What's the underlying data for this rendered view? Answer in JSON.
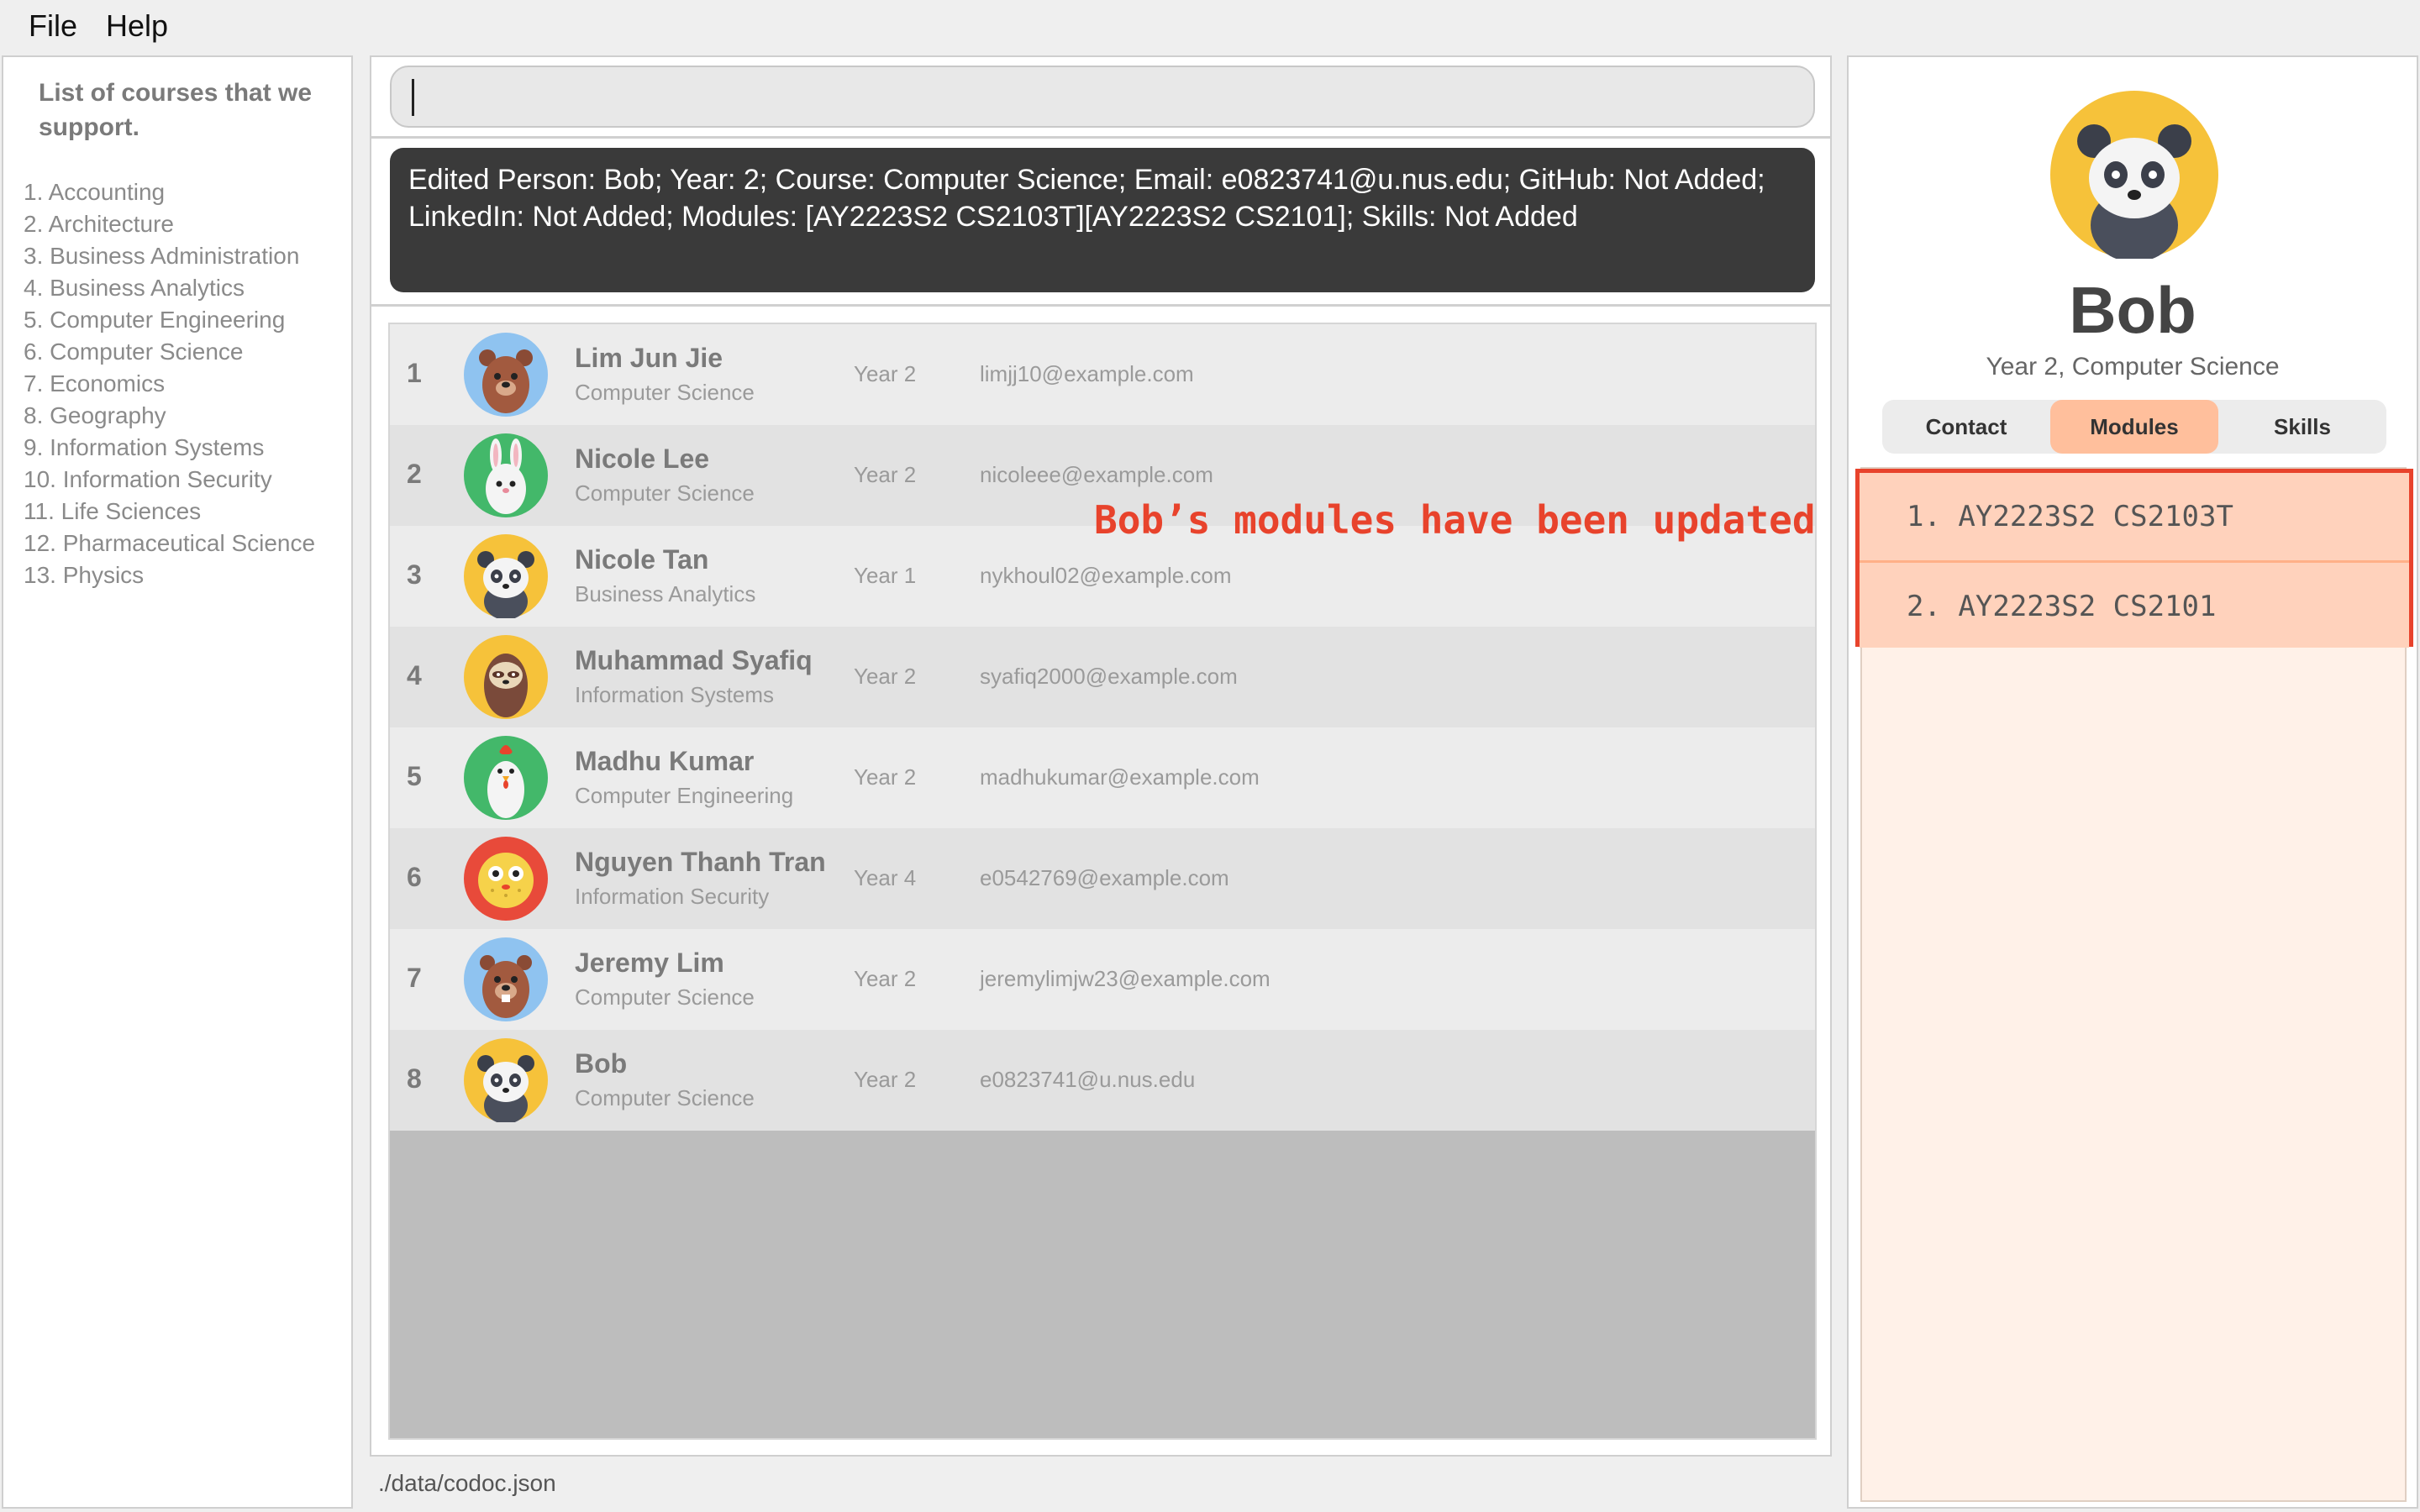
{
  "menu": {
    "file": "File",
    "help": "Help"
  },
  "sidebar": {
    "title": "List of courses that we support.",
    "courses": [
      "1. Accounting",
      "2. Architecture",
      "3. Business Administration",
      "4. Business Analytics",
      "5. Computer Engineering",
      "6. Computer Science",
      "7. Economics",
      "8. Geography",
      "9. Information Systems",
      "10. Information Security",
      "11. Life Sciences",
      "12. Pharmaceutical Science",
      "13. Physics"
    ]
  },
  "command": {
    "value": ""
  },
  "result": {
    "text": "Edited Person: Bob; Year: 2; Course: Computer Science; Email: e0823741@u.nus.edu; GitHub: Not Added; LinkedIn: Not Added; Modules: [AY2223S2 CS2103T][AY2223S2 CS2101]; Skills: Not Added"
  },
  "persons": [
    {
      "index": "1",
      "name": "Lim Jun Jie",
      "course": "Computer Science",
      "year": "Year 2",
      "email": "limjj10@example.com",
      "avatar": "bear-icon"
    },
    {
      "index": "2",
      "name": "Nicole Lee",
      "course": "Computer Science",
      "year": "Year 2",
      "email": "nicoleee@example.com",
      "avatar": "rabbit-icon"
    },
    {
      "index": "3",
      "name": "Nicole Tan",
      "course": "Business Analytics",
      "year": "Year 1",
      "email": "nykhoul02@example.com",
      "avatar": "panda-icon"
    },
    {
      "index": "4",
      "name": "Muhammad Syafiq",
      "course": "Information Systems",
      "year": "Year 2",
      "email": "syafiq2000@example.com",
      "avatar": "sloth-icon"
    },
    {
      "index": "5",
      "name": "Madhu Kumar",
      "course": "Computer Engineering",
      "year": "Year 2",
      "email": "madhukumar@example.com",
      "avatar": "chicken-icon"
    },
    {
      "index": "6",
      "name": "Nguyen Thanh Tran",
      "course": "Information Security",
      "year": "Year 4",
      "email": "e0542769@example.com",
      "avatar": "pufferfish-icon"
    },
    {
      "index": "7",
      "name": "Jeremy Lim",
      "course": "Computer Science",
      "year": "Year 2",
      "email": "jeremylimjw23@example.com",
      "avatar": "beaver-icon"
    },
    {
      "index": "8",
      "name": "Bob",
      "course": "Computer Science",
      "year": "Year 2",
      "email": "e0823741@u.nus.edu",
      "avatar": "panda-icon"
    }
  ],
  "status": {
    "path": "./data/codoc.json"
  },
  "detail": {
    "name": "Bob",
    "subtitle": "Year 2, Computer Science",
    "avatar": "panda-icon",
    "tabs": [
      "Contact",
      "Modules",
      "Skills"
    ],
    "active_tab": "Modules",
    "modules": [
      "1.  AY2223S2 CS2103T",
      "2.  AY2223S2 CS2101"
    ]
  },
  "annotation": {
    "text": "Bob’s modules have been updated"
  },
  "colors": {
    "accent": "#ffbf9c",
    "highlight": "#e8432c",
    "result_bg": "#3a3a3a"
  }
}
